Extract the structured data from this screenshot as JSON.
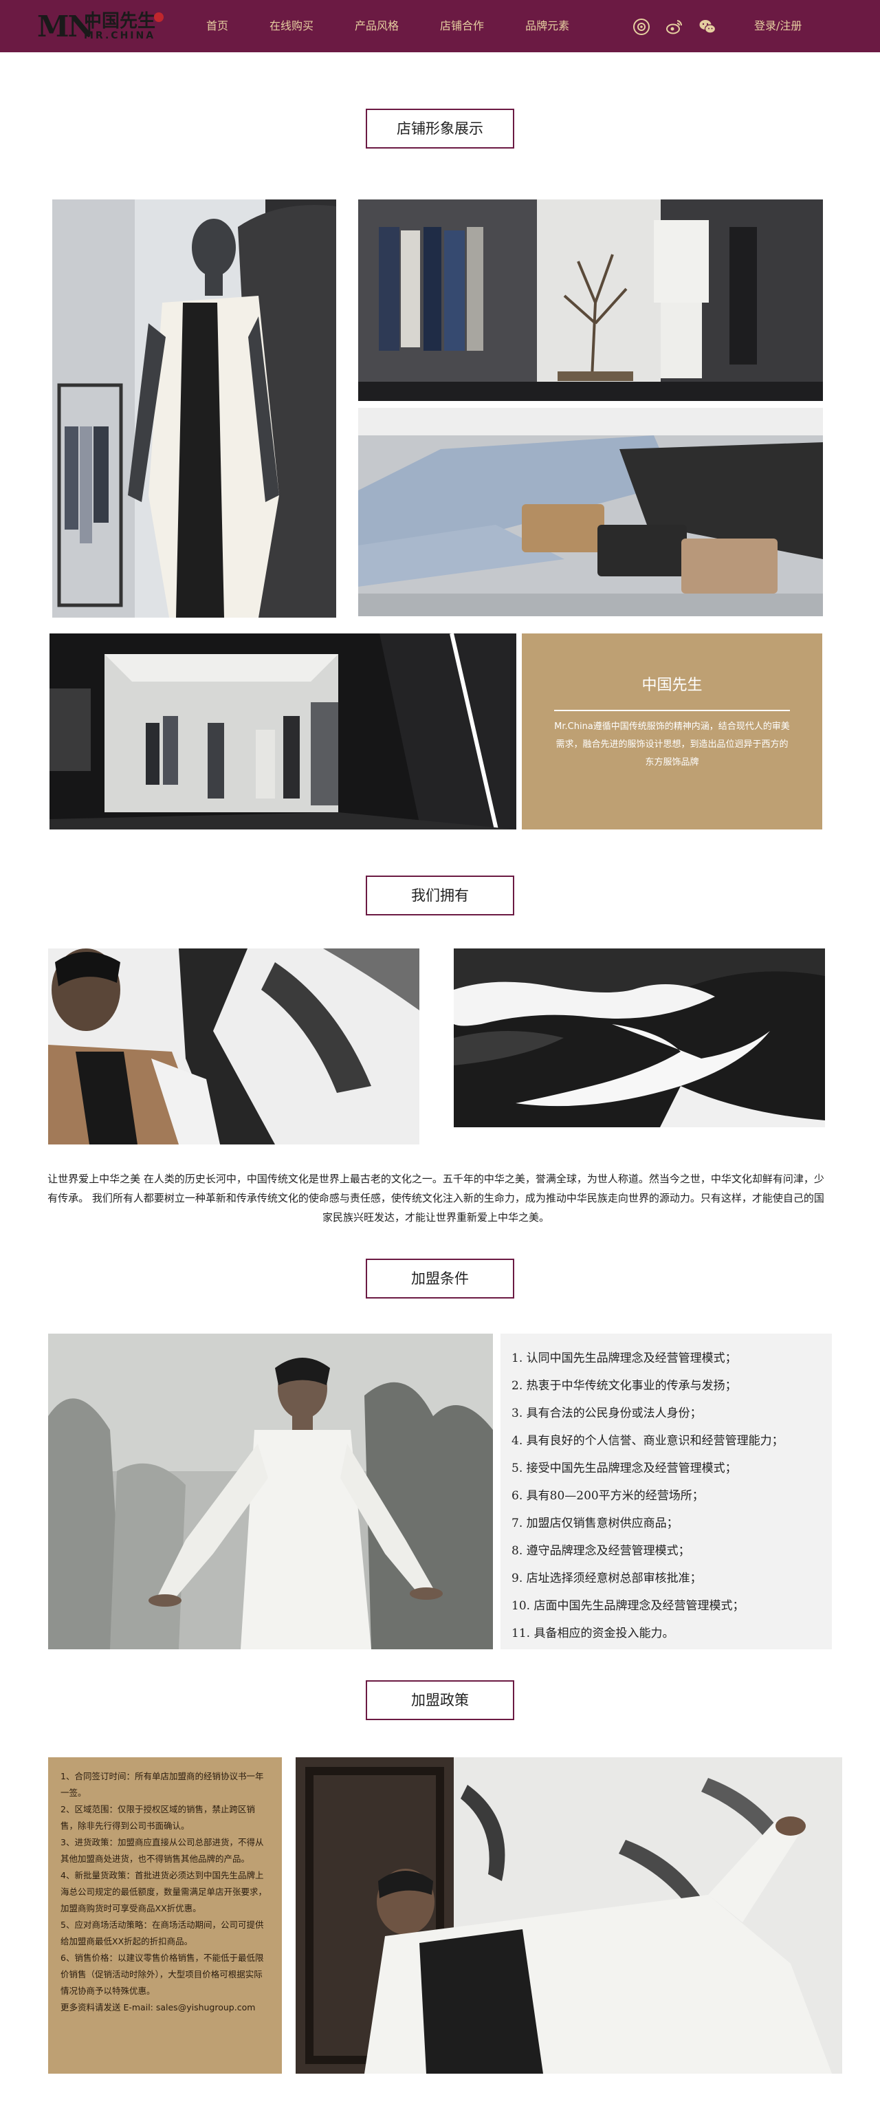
{
  "header": {
    "logo": {
      "mark": "MN",
      "cn": "中国先生",
      "en": "MR.CHINA"
    },
    "nav": [
      "首页",
      "在线购买",
      "产品风格",
      "店铺合作",
      "品牌元素"
    ],
    "icons": [
      "compass-icon",
      "weibo-icon",
      "wechat-icon"
    ],
    "login": "登录/注册"
  },
  "sections": {
    "store_display": "店铺形象展示",
    "we_have": "我们拥有",
    "join_conditions": "加盟条件",
    "join_policy": "加盟政策"
  },
  "brand_box": {
    "title": "中国先生",
    "desc": "Mr.China遵循中国传统服饰的精神内涵，结合现代人的审美需求，融合先进的服饰设计思想，到造出品位迥异于西方的东方服饰品牌"
  },
  "paragraph": "让世界爱上中华之美 在人类的历史长河中，中国传统文化是世界上最古老的文化之一。五千年的中华之美，誉满全球，为世人称道。然当今之世，中华文化却鲜有问津，少有传承。 我们所有人都要树立一种革新和传承传统文化的使命感与责任感，使传统文化注入新的生命力，成为推动中华民族走向世界的源动力。只有这样，才能使自己的国家民族兴旺发达，才能让世界重新爱上中华之美。",
  "conditions": [
    "1. 认同中国先生品牌理念及经营管理模式；",
    "2. 热衷于中华传统文化事业的传承与发扬；",
    "3. 具有合法的公民身份或法人身份；",
    "4. 具有良好的个人信誉、商业意识和经营管理能力；",
    "5. 接受中国先生品牌理念及经营管理模式；",
    "6. 具有80—200平方米的经营场所；",
    "7. 加盟店仅销售意树供应商品；",
    "8. 遵守品牌理念及经营管理模式；",
    "9. 店址选择须经意树总部审核批准；",
    "10. 店面中国先生品牌理念及经营管理模式；",
    "11. 具备相应的资金投入能力。"
  ],
  "policy": [
    "1、合同签订时间：所有单店加盟商的经销协议书一年一签。",
    "2、区域范围：仅限于授权区域的销售，禁止跨区销售，除非先行得到公司书面确认。",
    "3、进货政策：加盟商应直接从公司总部进货，不得从其他加盟商处进货，也不得销售其他品牌的产品。",
    "4、新批量货政策：首批进货必须达到中国先生品牌上海总公司规定的最低额度，数量需满足单店开张要求，加盟商购货时可享受商品XX折优惠。",
    "5、应对商场活动策略：在商场活动期间，公司可提供给加盟商最低XX折起的折扣商品。",
    "6、销售价格：以建议零售价格销售，不能低于最低限价销售（促销活动时除外），大型项目价格可根据实际情况协商予以特殊优惠。",
    "更多资料请发送 E-mail: sales@yishugroup.com"
  ],
  "photos": [
    "store-mannequin-photo",
    "store-rack-photo",
    "folded-clothes-photo",
    "store-interior-photo",
    "model-calligraphy-photo",
    "river-valley-photo",
    "model-arms-open-photo",
    "model-reclining-photo"
  ],
  "colors": {
    "primary": "#6b1a43",
    "nav_text": "#e6cfa0",
    "accent_gold": "#bea073",
    "panel_gray": "#f2f2f2"
  }
}
